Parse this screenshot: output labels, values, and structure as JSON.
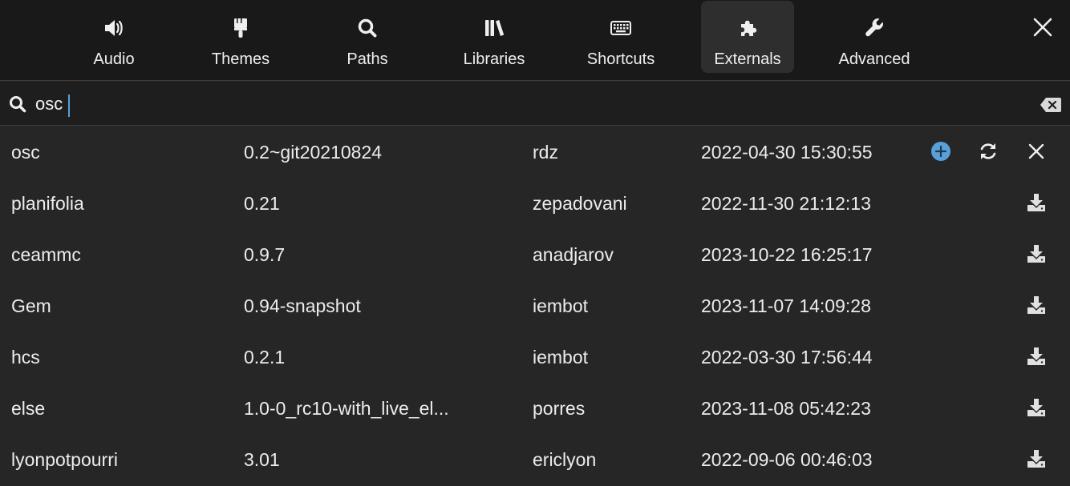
{
  "tabs": [
    {
      "id": "audio",
      "label": "Audio",
      "icon": "speaker-icon"
    },
    {
      "id": "themes",
      "label": "Themes",
      "icon": "paintbrush-icon"
    },
    {
      "id": "paths",
      "label": "Paths",
      "icon": "search-icon"
    },
    {
      "id": "libraries",
      "label": "Libraries",
      "icon": "books-icon"
    },
    {
      "id": "shortcuts",
      "label": "Shortcuts",
      "icon": "keyboard-icon"
    },
    {
      "id": "externals",
      "label": "Externals",
      "icon": "puzzle-icon",
      "active": true
    },
    {
      "id": "advanced",
      "label": "Advanced",
      "icon": "wrench-icon"
    }
  ],
  "search": {
    "value": "osc",
    "placeholder": ""
  },
  "colors": {
    "accent": "#5aa0d8",
    "background": "#262626",
    "toolbar": "#191919"
  },
  "results": [
    {
      "name": "osc",
      "version": "0.2~git20210824",
      "author": "rdz",
      "date": "2022-04-30 15:30:55",
      "installed": true
    },
    {
      "name": "planifolia",
      "version": "0.21",
      "author": "zepadovani",
      "date": "2022-11-30 21:12:13",
      "installed": false
    },
    {
      "name": "ceammc",
      "version": "0.9.7",
      "author": "anadjarov",
      "date": "2023-10-22 16:25:17",
      "installed": false
    },
    {
      "name": "Gem",
      "version": "0.94-snapshot",
      "author": "iembot",
      "date": "2023-11-07 14:09:28",
      "installed": false
    },
    {
      "name": "hcs",
      "version": "0.2.1",
      "author": "iembot",
      "date": "2022-03-30 17:56:44",
      "installed": false
    },
    {
      "name": "else",
      "version": "1.0-0_rc10-with_live_el...",
      "author": "porres",
      "date": "2023-11-08 05:42:23",
      "installed": false
    },
    {
      "name": "lyonpotpourri",
      "version": "3.01",
      "author": "ericlyon",
      "date": "2022-09-06 00:46:03",
      "installed": false
    }
  ]
}
